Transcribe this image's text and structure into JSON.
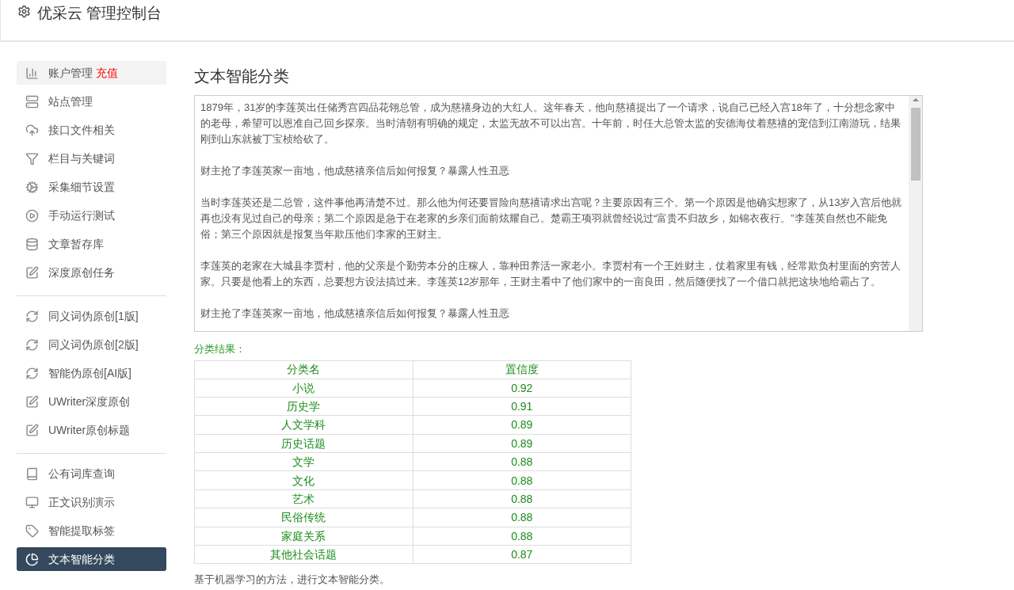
{
  "header": {
    "title": "优采云 管理控制台"
  },
  "sidebar": {
    "groups": [
      {
        "items": [
          {
            "label": "账户管理",
            "badge": "充值",
            "selected": false,
            "hovered": true
          },
          {
            "label": "站点管理",
            "selected": false,
            "hovered": false
          },
          {
            "label": "接口文件相关",
            "selected": false,
            "hovered": false
          },
          {
            "label": "栏目与关键词",
            "selected": false,
            "hovered": false
          },
          {
            "label": "采集细节设置",
            "selected": false,
            "hovered": false
          },
          {
            "label": "手动运行测试",
            "selected": false,
            "hovered": false
          },
          {
            "label": "文章暂存库",
            "selected": false,
            "hovered": false
          },
          {
            "label": "深度原创任务",
            "selected": false,
            "hovered": false
          }
        ]
      },
      {
        "items": [
          {
            "label": "同义词伪原创[1版]",
            "selected": false,
            "hovered": false
          },
          {
            "label": "同义词伪原创[2版]",
            "selected": false,
            "hovered": false
          },
          {
            "label": "智能伪原创[AI版]",
            "selected": false,
            "hovered": false
          },
          {
            "label": "UWriter深度原创",
            "selected": false,
            "hovered": false
          },
          {
            "label": "UWriter原创标题",
            "selected": false,
            "hovered": false
          }
        ]
      },
      {
        "items": [
          {
            "label": "公有词库查询",
            "selected": false,
            "hovered": false
          },
          {
            "label": "正文识别演示",
            "selected": false,
            "hovered": false
          },
          {
            "label": "智能提取标签",
            "selected": false,
            "hovered": false
          },
          {
            "label": "文本智能分类",
            "selected": true,
            "hovered": false
          }
        ]
      }
    ]
  },
  "main": {
    "title": "文本智能分类",
    "text_area": {
      "paragraphs": [
        "1879年，31岁的李莲英出任储秀宫四品花翎总管，成为慈禧身边的大红人。这年春天，他向慈禧提出了一个请求，说自己已经入宫18年了，十分想念家中的老母，希望可以恩准自己回乡探亲。当时清朝有明确的规定，太监无故不可以出宫。十年前，时任大总管太监的安德海仗着慈禧的宠信到江南游玩，结果刚到山东就被丁宝桢给砍了。",
        "财主抢了李莲英家一亩地，他成慈禧亲信后如何报复？暴露人性丑恶",
        "当时李莲英还是二总管，这件事他再清楚不过。那么他为何还要冒险向慈禧请求出宫呢？主要原因有三个。第一个原因是他确实想家了，从13岁入宫后他就再也没有见过自己的母亲；第二个原因是急于在老家的乡亲们面前炫耀自己。楚霸王项羽就曾经说过“富贵不归故乡，如锦衣夜行。”李莲英自然也不能免俗；第三个原因就是报复当年欺压他们李家的王财主。",
        "李莲英的老家在大城县李贾村，他的父亲是个勤劳本分的庄稼人，靠种田养活一家老小。李贾村有一个王姓财主，仗着家里有钱，经常欺负村里面的穷苦人家。只要是他看上的东西，总要想方设法搞过来。李莲英12岁那年，王财主看中了他们家中的一亩良田，然后随便找了一个借口就把这块地给霸占了。",
        "财主抢了李莲英家一亩地，他成慈禧亲信后如何报复？暴露人性丑恶"
      ]
    },
    "result_label": "分类结果：",
    "table": {
      "columns": [
        "分类名",
        "置信度"
      ],
      "rows": [
        [
          "小说",
          "0.92"
        ],
        [
          "历史学",
          "0.91"
        ],
        [
          "人文学科",
          "0.89"
        ],
        [
          "历史话题",
          "0.89"
        ],
        [
          "文学",
          "0.88"
        ],
        [
          "文化",
          "0.88"
        ],
        [
          "艺术",
          "0.88"
        ],
        [
          "民俗传统",
          "0.88"
        ],
        [
          "家庭关系",
          "0.88"
        ],
        [
          "其他社会话题",
          "0.87"
        ]
      ]
    },
    "note": "基于机器学习的方法，进行文本智能分类。"
  }
}
